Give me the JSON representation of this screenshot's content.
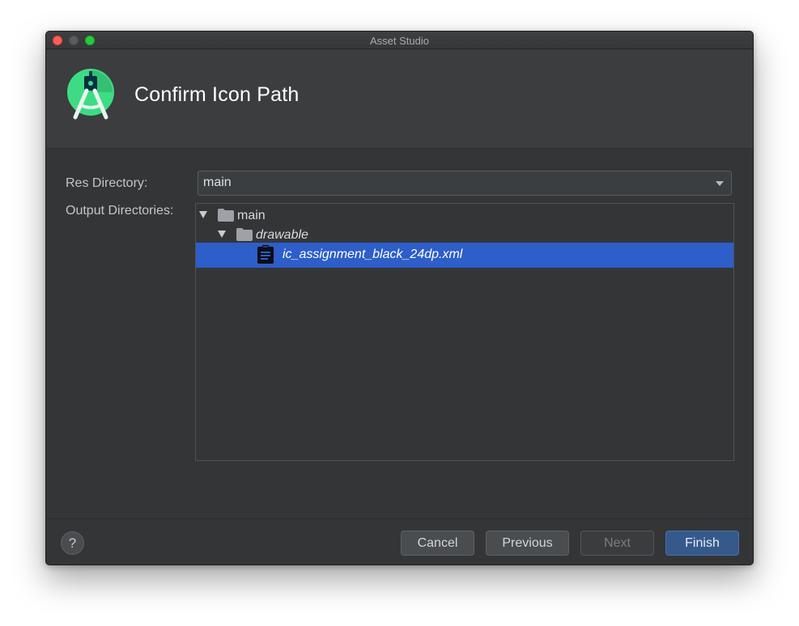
{
  "window": {
    "title": "Asset Studio"
  },
  "header": {
    "title": "Confirm Icon Path",
    "logo_icon": "android-studio-logo-icon"
  },
  "form": {
    "res_directory_label": "Res Directory:",
    "res_directory_value": "main",
    "output_directories_label": "Output Directories:"
  },
  "tree": {
    "items": [
      {
        "label": "main",
        "icon": "folder-icon",
        "expanded": true,
        "italic": false,
        "selected": false
      },
      {
        "label": "drawable",
        "icon": "folder-icon",
        "expanded": true,
        "italic": true,
        "selected": false
      },
      {
        "label": "ic_assignment_black_24dp.xml",
        "icon": "assignment-file-icon",
        "italic": true,
        "selected": true
      }
    ]
  },
  "footer": {
    "help_label": "?",
    "cancel_label": "Cancel",
    "previous_label": "Previous",
    "next_label": "Next",
    "finish_label": "Finish"
  },
  "colors": {
    "selection": "#2d5ec9",
    "background": "#333537",
    "header": "#3b3d3f",
    "primary_button": "#36598c",
    "android_green": "#3ddc84"
  }
}
